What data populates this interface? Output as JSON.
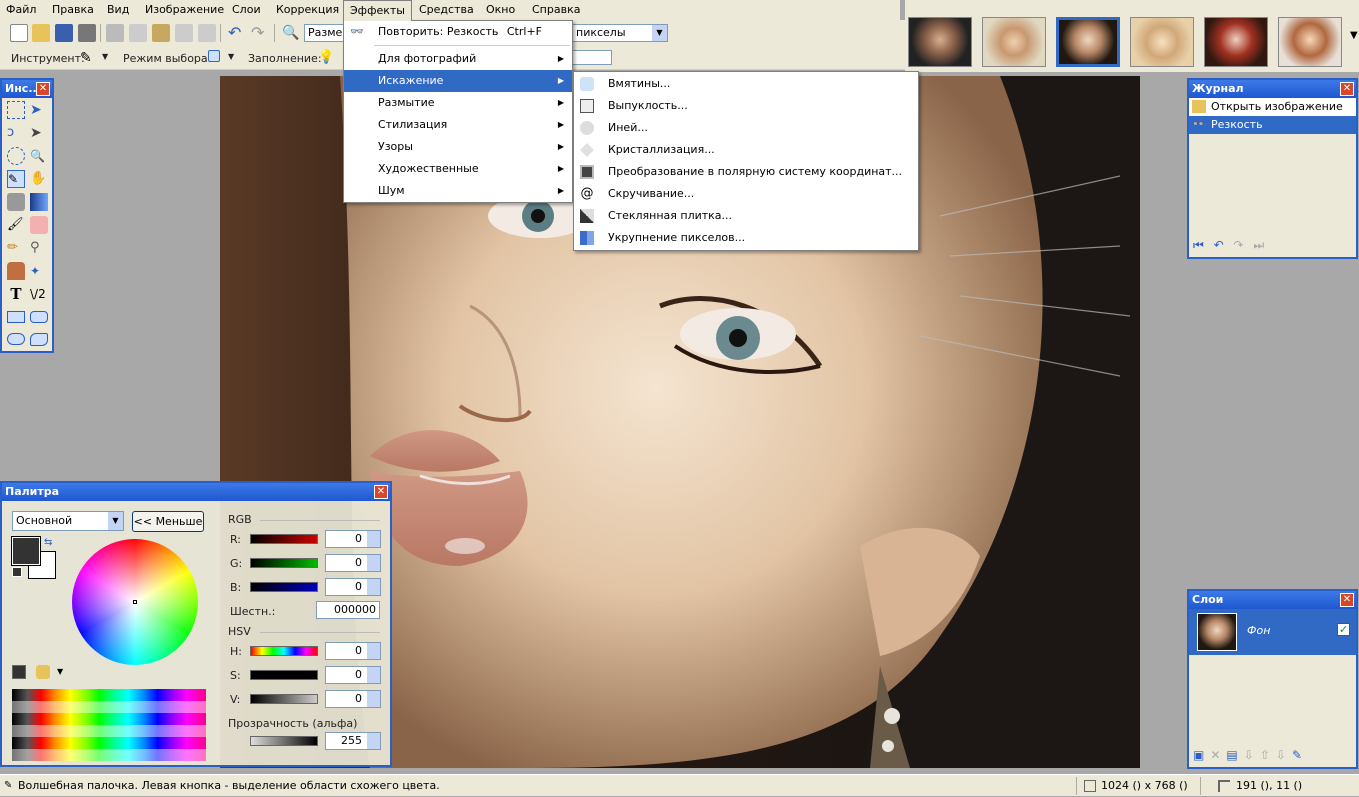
{
  "menubar": {
    "items": [
      "Файл",
      "Правка",
      "Вид",
      "Изображение",
      "Слои",
      "Коррекция",
      "Эффекты",
      "Средства",
      "Окно",
      "Справка"
    ],
    "open_item": "Эффекты"
  },
  "toolbar": {
    "size_label": "Размер",
    "units_value": "пикселы",
    "instrument_label": "Инструмент:",
    "selection_mode_label": "Режим выбора:",
    "fill_label": "Заполнение:"
  },
  "effects_menu": {
    "repeat_label": "Повторить: Резкость",
    "repeat_shortcut": "Ctrl+F",
    "items": [
      "Для фотографий",
      "Искажение",
      "Размытие",
      "Стилизация",
      "Узоры",
      "Художественные",
      "Шум"
    ],
    "highlighted": "Искажение"
  },
  "distort_submenu": {
    "items": [
      "Вмятины...",
      "Выпуклость...",
      "Иней...",
      "Кристаллизация...",
      "Преобразование в полярную систему координат...",
      "Скручивание...",
      "Стеклянная плитка...",
      "Укрупнение пикселов..."
    ]
  },
  "tools_panel": {
    "title": "Инс..."
  },
  "history_panel": {
    "title": "Журнал",
    "items": [
      "Открыть изображение",
      "Резкость"
    ],
    "selected": "Резкость"
  },
  "layers_panel": {
    "title": "Слои",
    "layer_name": "Фон"
  },
  "palette_panel": {
    "title": "Палитра",
    "mode_value": "Основной",
    "less_button": "<< Меньше",
    "rgb_label": "RGB",
    "r_label": "R:",
    "r_value": "0",
    "g_label": "G:",
    "g_value": "0",
    "b_label": "B:",
    "b_value": "0",
    "hex_label": "Шестн.:",
    "hex_value": "000000",
    "hsv_label": "HSV",
    "h_label": "H:",
    "h_value": "0",
    "s_label": "S:",
    "s_value": "0",
    "v_label": "V:",
    "v_value": "0",
    "alpha_label": "Прозрачность (альфа)",
    "alpha_value": "255"
  },
  "statusbar": {
    "hint": "Волшебная палочка. Левая кнопка - выделение области схожего цвета.",
    "image_size": "1024 () x 768 ()",
    "cursor_pos": "191 (), 11 ()"
  },
  "colors": {
    "accent": "#316ac5",
    "titlebar": "#2a5fc8",
    "chrome": "#ece9d8"
  }
}
